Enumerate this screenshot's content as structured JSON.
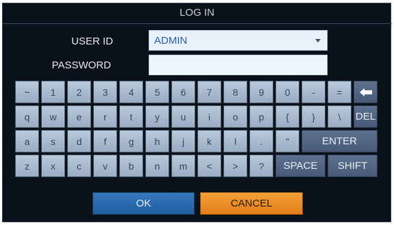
{
  "dialog": {
    "title": "LOG IN"
  },
  "form": {
    "user_id_label": "USER ID",
    "user_id_value": "ADMIN",
    "password_label": "PASSWORD",
    "password_value": ""
  },
  "keyboard": {
    "row1": [
      "~",
      "1",
      "2",
      "3",
      "4",
      "5",
      "6",
      "7",
      "8",
      "9",
      "0",
      "-",
      "="
    ],
    "row1_special": "backspace-icon",
    "row2": [
      "q",
      "w",
      "e",
      "r",
      "t",
      "y",
      "u",
      "i",
      "o",
      "p",
      "{",
      "}",
      "\\"
    ],
    "row2_special": "DEL",
    "row3": [
      "a",
      "s",
      "d",
      "f",
      "g",
      "h",
      "j",
      "k",
      "l",
      ".",
      "\""
    ],
    "row3_special": "ENTER",
    "row4": [
      "z",
      "x",
      "c",
      "v",
      "b",
      "n",
      "m",
      "<",
      ">",
      "?"
    ],
    "row4_special": [
      "SPACE",
      "SHIFT"
    ]
  },
  "buttons": {
    "ok": "OK",
    "cancel": "CANCEL"
  },
  "colors": {
    "background": "#0b111b",
    "key": "#a8bbd0",
    "key_dark": "#51667f",
    "ok": "#2a6bb0",
    "cancel": "#ef8c25"
  }
}
